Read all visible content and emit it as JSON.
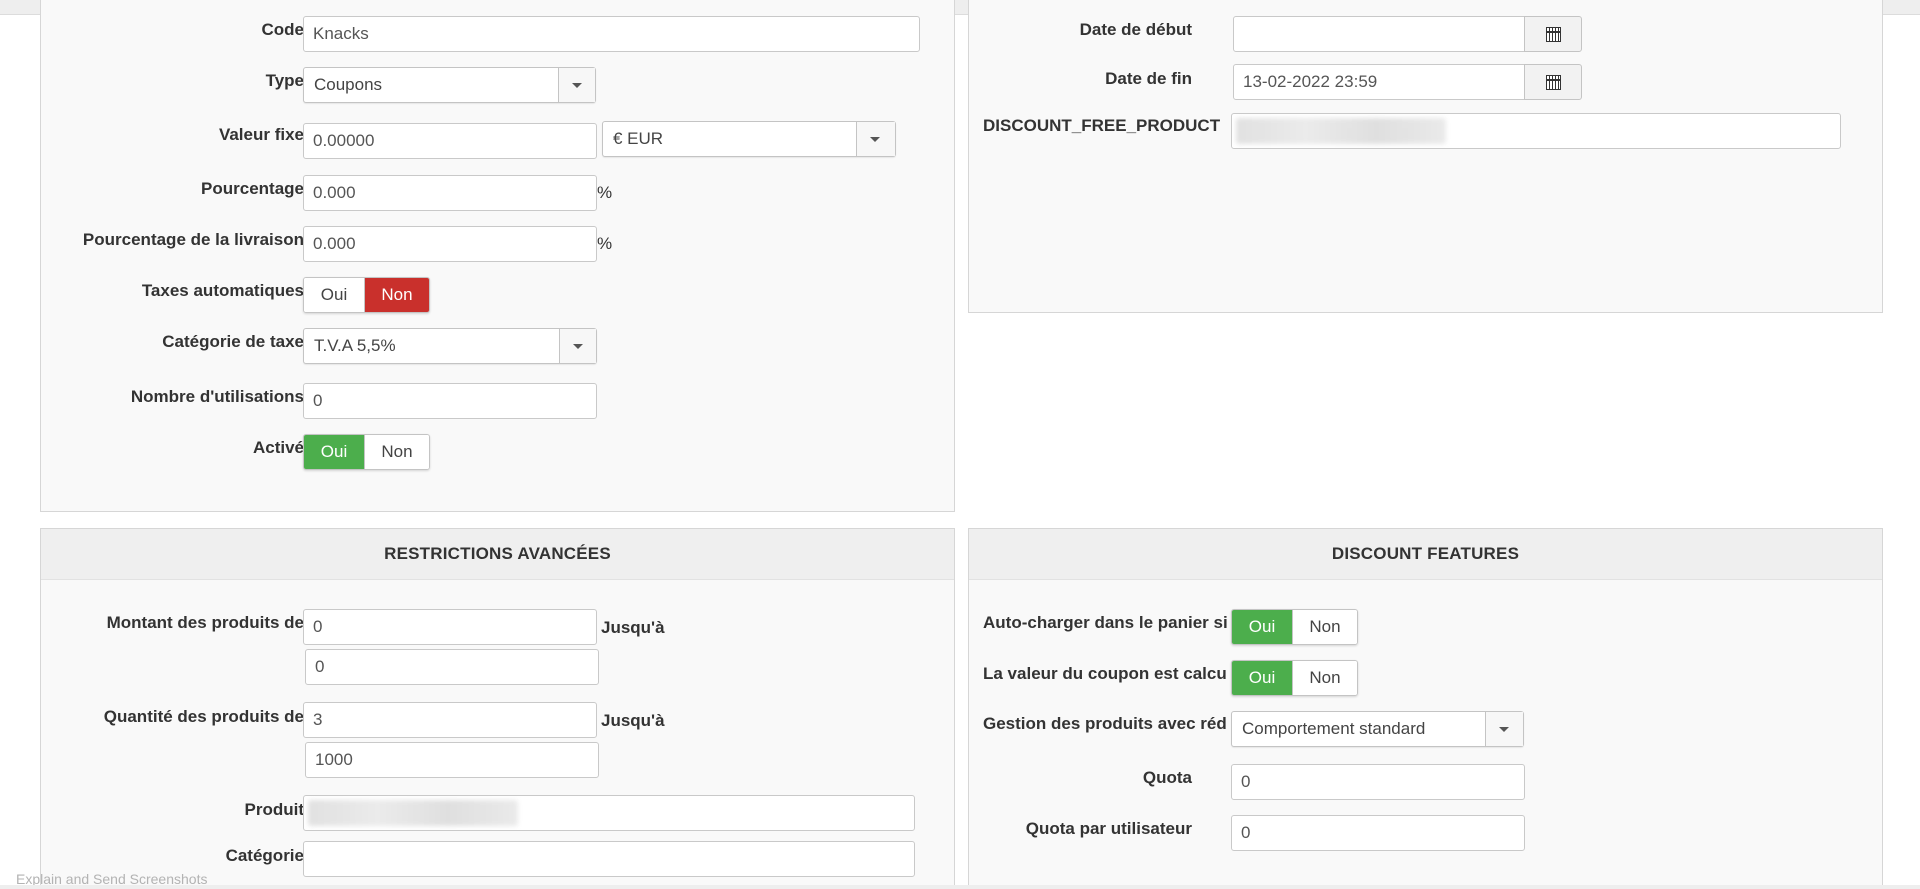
{
  "left_top": {
    "code": {
      "label": "Code",
      "value": "Knacks"
    },
    "type": {
      "label": "Type",
      "value": "Coupons"
    },
    "valeur_fixe": {
      "label": "Valeur fixe",
      "value": "0.00000",
      "currency": "€ EUR"
    },
    "pourcentage": {
      "label": "Pourcentage",
      "value": "0.000",
      "unit": "%"
    },
    "pourcentage_livraison": {
      "label": "Pourcentage de la livraison",
      "value": "0.000",
      "unit": "%"
    },
    "taxes_auto": {
      "label": "Taxes automatiques",
      "yes": "Oui",
      "no": "Non",
      "selected": "no"
    },
    "categorie_taxe": {
      "label": "Catégorie de taxe",
      "value": "T.V.A 5,5%"
    },
    "nombre_utilisations": {
      "label": "Nombre d'utilisations",
      "value": "0"
    },
    "active": {
      "label": "Activé",
      "yes": "Oui",
      "no": "Non",
      "selected": "yes"
    }
  },
  "right_top": {
    "date_debut": {
      "label": "Date de début",
      "value": ""
    },
    "date_fin": {
      "label": "Date de fin",
      "value": "13-02-2022 23:59"
    },
    "free_product": {
      "label": "DISCOUNT_FREE_PRODUCT"
    }
  },
  "restrictions": {
    "title": "RESTRICTIONS AVANCÉES",
    "montant": {
      "label": "Montant des produits de",
      "from": "0",
      "to_label": "Jusqu'à",
      "to": "0"
    },
    "quantite": {
      "label": "Quantité des produits de",
      "from": "3",
      "to_label": "Jusqu'à",
      "to": "1000"
    },
    "produit": {
      "label": "Produit"
    },
    "categorie": {
      "label": "Catégorie",
      "value": ""
    }
  },
  "features": {
    "title": "DISCOUNT FEATURES",
    "auto_charger": {
      "label": "Auto-charger dans le panier si",
      "yes": "Oui",
      "no": "Non",
      "selected": "yes"
    },
    "valeur_coupon": {
      "label": "La valeur du coupon est calcu",
      "yes": "Oui",
      "no": "Non",
      "selected": "yes"
    },
    "gestion": {
      "label": "Gestion des produits avec réd",
      "value": "Comportement standard"
    },
    "quota": {
      "label": "Quota",
      "value": "0"
    },
    "quota_user": {
      "label": "Quota par utilisateur",
      "value": "0"
    }
  },
  "footer": {
    "text": "Explain and Send Screenshots"
  },
  "colors": {
    "green": "#4cae4c",
    "red": "#c9302c"
  }
}
